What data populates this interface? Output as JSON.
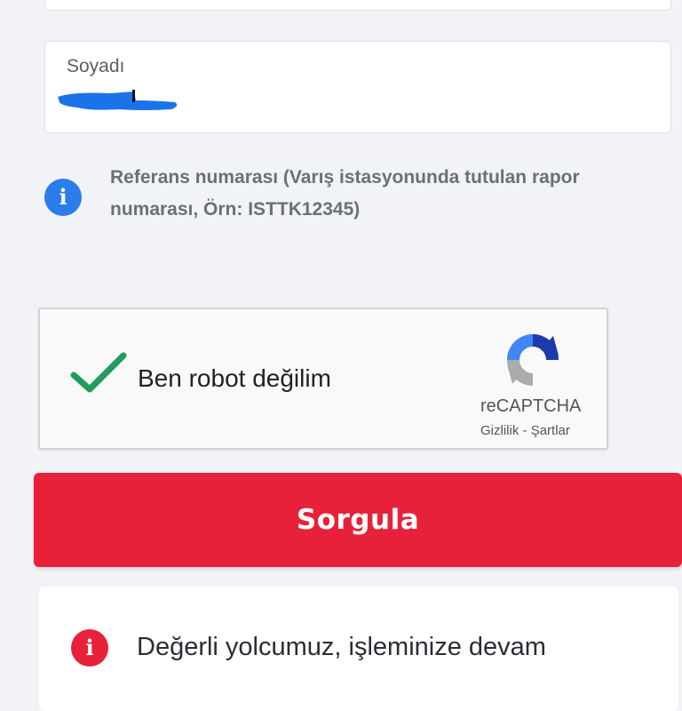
{
  "form": {
    "surname_label": "Soyadı",
    "info_text": "Referans numarası (Varış istasyonunda tutulan rapor numarası, Örn: ISTTK12345)",
    "info_icon_glyph": "i"
  },
  "captcha": {
    "label": "Ben robot değilim",
    "brand": "reCAPTCHA",
    "privacy": "Gizlilik",
    "separator": " - ",
    "terms": "Şartlar",
    "check_color": "#1e9d5c"
  },
  "actions": {
    "submit_label": "Sorgula",
    "submit_color": "#e8213a"
  },
  "notice": {
    "icon_glyph": "i",
    "text": "Değerli yolcumuz, işleminize devam"
  }
}
